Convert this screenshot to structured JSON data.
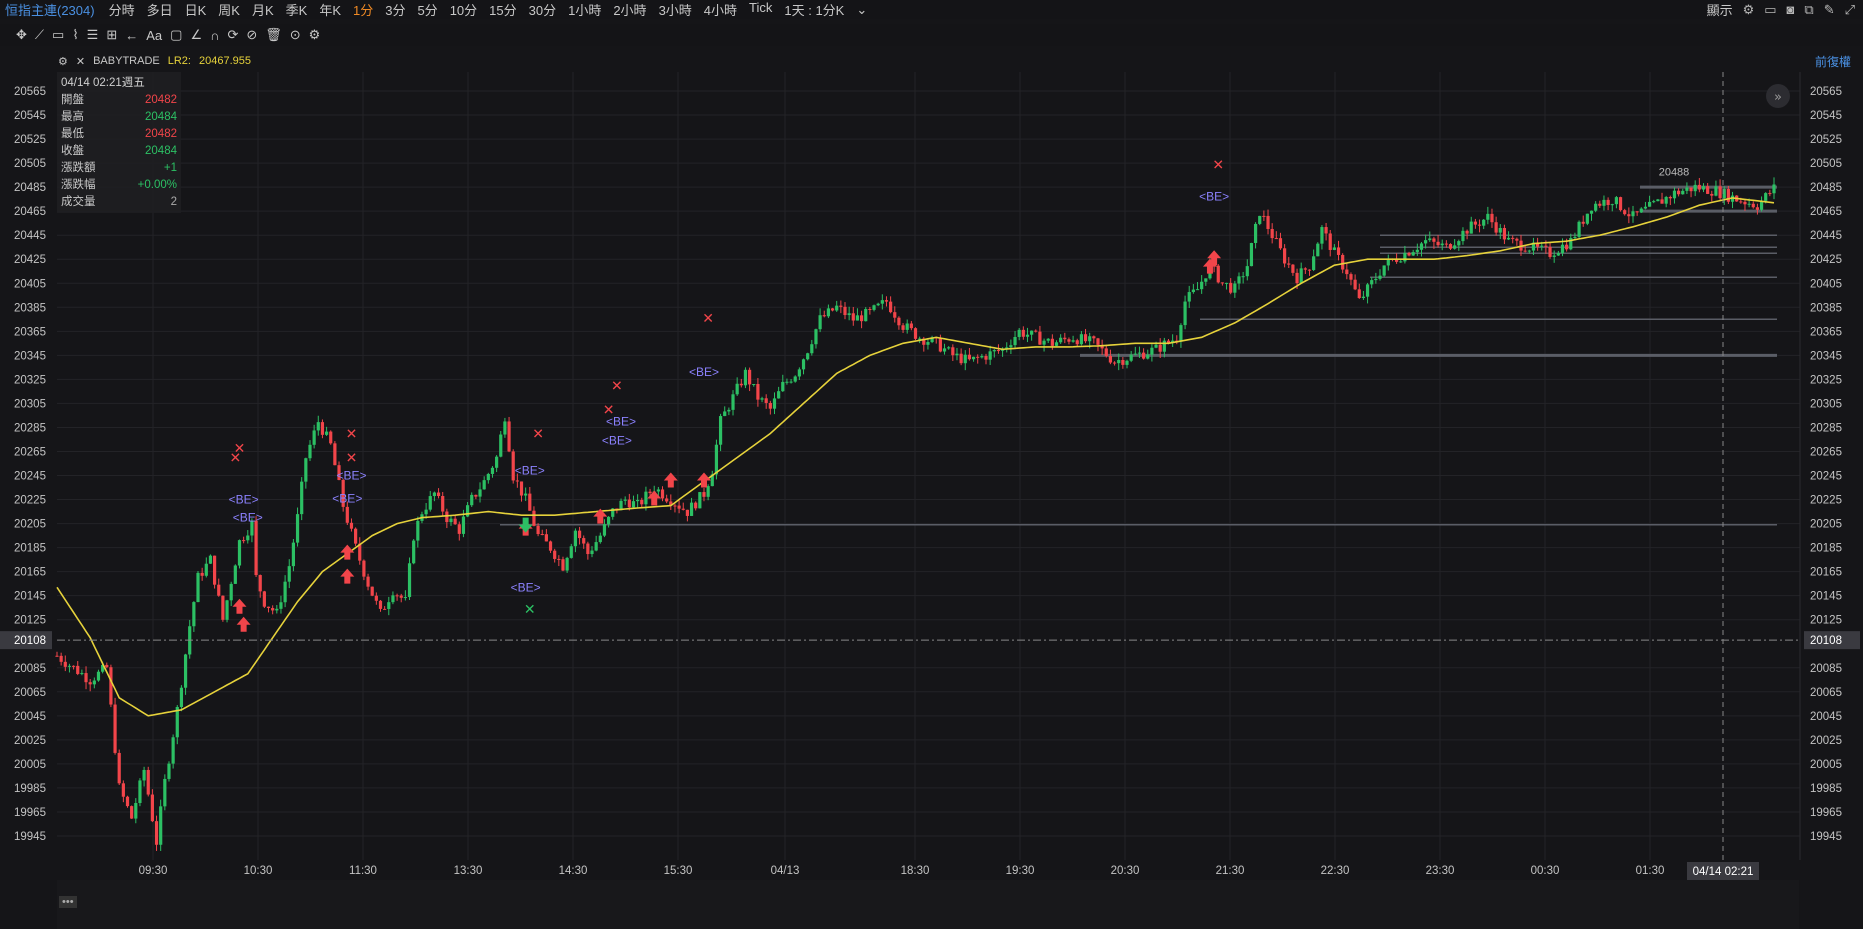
{
  "topbar": {
    "symbol": "恒指主連(2304)",
    "timeframes": [
      "分時",
      "多日",
      "日K",
      "周K",
      "月K",
      "季K",
      "年K",
      "1分",
      "3分",
      "5分",
      "10分",
      "15分",
      "30分",
      "1小時",
      "2小時",
      "3小時",
      "4小時",
      "Tick"
    ],
    "active_timeframe": "1分",
    "period_select": "1天 : 1分K",
    "display_label": "顯示"
  },
  "subbar": {
    "source": "BABYTRADE",
    "indicator_label": "LR2:",
    "indicator_value": "20467.955",
    "adjust_label": "前復權"
  },
  "infobox": {
    "date": "04/14 02:21週五",
    "rows": [
      {
        "k": "開盤",
        "v": "20482",
        "c": "dn"
      },
      {
        "k": "最高",
        "v": "20484",
        "c": "up"
      },
      {
        "k": "最低",
        "v": "20482",
        "c": "dn"
      },
      {
        "k": "收盤",
        "v": "20484",
        "c": "up"
      },
      {
        "k": "漲跌額",
        "v": "+1",
        "c": "up"
      },
      {
        "k": "漲跌幅",
        "v": "+0.00%",
        "c": "up"
      },
      {
        "k": "成交量",
        "v": "2",
        "c": "gray"
      }
    ]
  },
  "colors": {
    "up": "#2cc064",
    "down": "#f2454a",
    "ma": "#e6d23b",
    "be": "#8c82ff",
    "grid": "#232327",
    "active": "#f08a24"
  },
  "chart_data": {
    "type": "candlestick",
    "y_ticks": [
      20565,
      20545,
      20525,
      20505,
      20485,
      20465,
      20445,
      20425,
      20405,
      20385,
      20365,
      20345,
      20325,
      20305,
      20285,
      20265,
      20245,
      20225,
      20205,
      20185,
      20165,
      20145,
      20125,
      20085,
      20065,
      20045,
      20025,
      20005,
      19985,
      19965,
      19945
    ],
    "x_ticks": [
      "09:30",
      "10:30",
      "11:30",
      "13:30",
      "14:30",
      "15:30",
      "04/13",
      "18:30",
      "19:30",
      "20:30",
      "21:30",
      "22:30",
      "23:30",
      "00:30",
      "01:30"
    ],
    "crosshair_price": 20108,
    "crosshair_time": "04/14 02:21",
    "last_price_marker": 20488,
    "price_path": [
      [
        0,
        20095
      ],
      [
        8,
        20075
      ],
      [
        12,
        20085
      ],
      [
        15,
        19985
      ],
      [
        18,
        19960
      ],
      [
        21,
        20000
      ],
      [
        24,
        19940
      ],
      [
        26,
        19990
      ],
      [
        29,
        20050
      ],
      [
        32,
        20120
      ],
      [
        34,
        20160
      ],
      [
        37,
        20175
      ],
      [
        40,
        20125
      ],
      [
        44,
        20190
      ],
      [
        47,
        20205
      ],
      [
        48,
        20160
      ],
      [
        50,
        20140
      ],
      [
        53,
        20130
      ],
      [
        56,
        20170
      ],
      [
        58,
        20210
      ],
      [
        60,
        20260
      ],
      [
        63,
        20290
      ],
      [
        66,
        20270
      ],
      [
        69,
        20220
      ],
      [
        72,
        20185
      ],
      [
        75,
        20155
      ],
      [
        78,
        20130
      ],
      [
        81,
        20150
      ],
      [
        84,
        20140
      ],
      [
        86,
        20195
      ],
      [
        88,
        20215
      ],
      [
        91,
        20230
      ],
      [
        94,
        20210
      ],
      [
        97,
        20200
      ],
      [
        100,
        20225
      ],
      [
        103,
        20240
      ],
      [
        106,
        20260
      ],
      [
        108,
        20295
      ],
      [
        110,
        20245
      ],
      [
        113,
        20225
      ],
      [
        116,
        20195
      ],
      [
        119,
        20185
      ],
      [
        122,
        20170
      ],
      [
        125,
        20200
      ],
      [
        128,
        20180
      ],
      [
        131,
        20195
      ],
      [
        134,
        20215
      ],
      [
        137,
        20225
      ],
      [
        140,
        20220
      ],
      [
        144,
        20235
      ],
      [
        148,
        20225
      ],
      [
        152,
        20215
      ],
      [
        156,
        20230
      ],
      [
        158,
        20250
      ],
      [
        160,
        20290
      ],
      [
        163,
        20310
      ],
      [
        166,
        20330
      ],
      [
        169,
        20310
      ],
      [
        172,
        20300
      ],
      [
        175,
        20320
      ],
      [
        178,
        20330
      ],
      [
        181,
        20350
      ],
      [
        184,
        20375
      ],
      [
        188,
        20385
      ],
      [
        192,
        20375
      ],
      [
        196,
        20380
      ],
      [
        200,
        20390
      ],
      [
        204,
        20370
      ],
      [
        208,
        20360
      ],
      [
        212,
        20355
      ],
      [
        216,
        20345
      ],
      [
        220,
        20340
      ],
      [
        224,
        20345
      ],
      [
        228,
        20350
      ],
      [
        232,
        20365
      ],
      [
        236,
        20360
      ],
      [
        240,
        20355
      ],
      [
        245,
        20360
      ],
      [
        250,
        20355
      ],
      [
        255,
        20340
      ],
      [
        260,
        20345
      ],
      [
        265,
        20350
      ],
      [
        270,
        20360
      ],
      [
        272,
        20390
      ],
      [
        275,
        20400
      ],
      [
        278,
        20420
      ],
      [
        281,
        20405
      ],
      [
        284,
        20400
      ],
      [
        287,
        20420
      ],
      [
        290,
        20465
      ],
      [
        293,
        20445
      ],
      [
        296,
        20425
      ],
      [
        299,
        20410
      ],
      [
        302,
        20420
      ],
      [
        305,
        20450
      ],
      [
        308,
        20430
      ],
      [
        311,
        20415
      ],
      [
        314,
        20390
      ],
      [
        317,
        20405
      ],
      [
        320,
        20420
      ],
      [
        325,
        20430
      ],
      [
        330,
        20440
      ],
      [
        335,
        20435
      ],
      [
        340,
        20450
      ],
      [
        345,
        20460
      ],
      [
        350,
        20440
      ],
      [
        355,
        20435
      ],
      [
        360,
        20430
      ],
      [
        365,
        20440
      ],
      [
        370,
        20470
      ],
      [
        375,
        20475
      ],
      [
        380,
        20460
      ],
      [
        385,
        20470
      ],
      [
        390,
        20480
      ],
      [
        395,
        20485
      ],
      [
        400,
        20482
      ],
      [
        405,
        20475
      ],
      [
        410,
        20470
      ],
      [
        414,
        20484
      ]
    ],
    "ma_path": [
      [
        0,
        20152
      ],
      [
        8,
        20110
      ],
      [
        15,
        20060
      ],
      [
        22,
        20045
      ],
      [
        30,
        20050
      ],
      [
        38,
        20065
      ],
      [
        46,
        20080
      ],
      [
        52,
        20110
      ],
      [
        58,
        20140
      ],
      [
        64,
        20165
      ],
      [
        70,
        20180
      ],
      [
        76,
        20195
      ],
      [
        82,
        20205
      ],
      [
        88,
        20210
      ],
      [
        96,
        20212
      ],
      [
        104,
        20215
      ],
      [
        112,
        20212
      ],
      [
        120,
        20212
      ],
      [
        130,
        20215
      ],
      [
        140,
        20218
      ],
      [
        148,
        20220
      ],
      [
        156,
        20240
      ],
      [
        164,
        20260
      ],
      [
        172,
        20280
      ],
      [
        180,
        20305
      ],
      [
        188,
        20330
      ],
      [
        196,
        20345
      ],
      [
        204,
        20355
      ],
      [
        212,
        20360
      ],
      [
        220,
        20355
      ],
      [
        228,
        20350
      ],
      [
        236,
        20352
      ],
      [
        244,
        20352
      ],
      [
        252,
        20353
      ],
      [
        260,
        20355
      ],
      [
        268,
        20355
      ],
      [
        276,
        20360
      ],
      [
        284,
        20372
      ],
      [
        292,
        20388
      ],
      [
        300,
        20405
      ],
      [
        308,
        20420
      ],
      [
        316,
        20425
      ],
      [
        324,
        20425
      ],
      [
        332,
        20425
      ],
      [
        340,
        20428
      ],
      [
        348,
        20432
      ],
      [
        356,
        20438
      ],
      [
        364,
        20440
      ],
      [
        372,
        20445
      ],
      [
        380,
        20452
      ],
      [
        388,
        20460
      ],
      [
        396,
        20470
      ],
      [
        404,
        20476
      ],
      [
        414,
        20472
      ]
    ],
    "markers_buy_up": [
      [
        44,
        20135
      ],
      [
        45,
        20120
      ],
      [
        70,
        20180
      ],
      [
        70,
        20160
      ],
      [
        113,
        20200
      ],
      [
        131,
        20210
      ],
      [
        144,
        20225
      ],
      [
        148,
        20240
      ],
      [
        156,
        20240
      ],
      [
        278,
        20418
      ],
      [
        279,
        20425
      ]
    ],
    "markers_sell_x": [
      [
        43,
        20260
      ],
      [
        44,
        20268
      ],
      [
        71,
        20260
      ],
      [
        71,
        20280
      ],
      [
        116,
        20280
      ],
      [
        133,
        20300
      ],
      [
        135,
        20320
      ],
      [
        157,
        20376
      ],
      [
        280,
        20504
      ]
    ],
    "markers_green_down": [
      [
        113,
        20205
      ]
    ],
    "markers_green_x": [
      [
        114,
        20134
      ]
    ],
    "be_labels": [
      [
        45,
        20225
      ],
      [
        46,
        20210
      ],
      [
        71,
        20245
      ],
      [
        70,
        20226
      ],
      [
        114,
        20249
      ],
      [
        113,
        20152
      ],
      [
        136,
        20290
      ],
      [
        135,
        20274
      ],
      [
        156,
        20331
      ],
      [
        279,
        20477
      ]
    ],
    "be_text": "<BE>",
    "support_lines": [
      20485,
      20465,
      20445,
      20435,
      20430,
      20410,
      20375,
      20345,
      20204
    ]
  },
  "nav": {
    "left_label": "•••"
  }
}
